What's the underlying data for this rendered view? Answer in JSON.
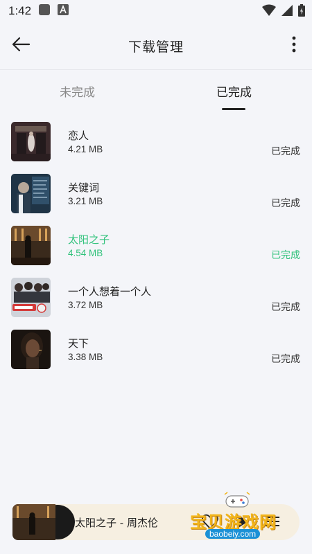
{
  "status_bar": {
    "time": "1:42",
    "icons": [
      "notification-square-icon",
      "a-icon",
      "wifi-icon",
      "signal-icon",
      "battery-icon"
    ]
  },
  "header": {
    "title": "下载管理",
    "back_icon": "arrow-left-icon",
    "more_icon": "more-vertical-icon"
  },
  "tabs": [
    {
      "label": "未完成",
      "selected": false
    },
    {
      "label": "已完成",
      "selected": true
    }
  ],
  "downloads": [
    {
      "name": "恋人",
      "size": "4.21 MB",
      "status": "已完成",
      "active": false
    },
    {
      "name": "关键词",
      "size": "3.21 MB",
      "status": "已完成",
      "active": false
    },
    {
      "name": "太阳之子",
      "size": "4.54 MB",
      "status": "已完成",
      "active": true
    },
    {
      "name": "一个人想着一个人",
      "size": "3.72 MB",
      "status": "已完成",
      "active": false
    },
    {
      "name": "天下",
      "size": "3.38 MB",
      "status": "已完成",
      "active": false
    }
  ],
  "mini_player": {
    "title": "太阳之子 - 周杰伦",
    "icons": [
      "heart-icon",
      "play-icon",
      "playlist-icon"
    ]
  },
  "watermark": {
    "name": "宝贝游戏网",
    "url": "baobeiy.com"
  },
  "colors": {
    "accent_green": "#31c27c",
    "background": "#f4f5f9",
    "mini_player_bg": "#f6efe1"
  }
}
